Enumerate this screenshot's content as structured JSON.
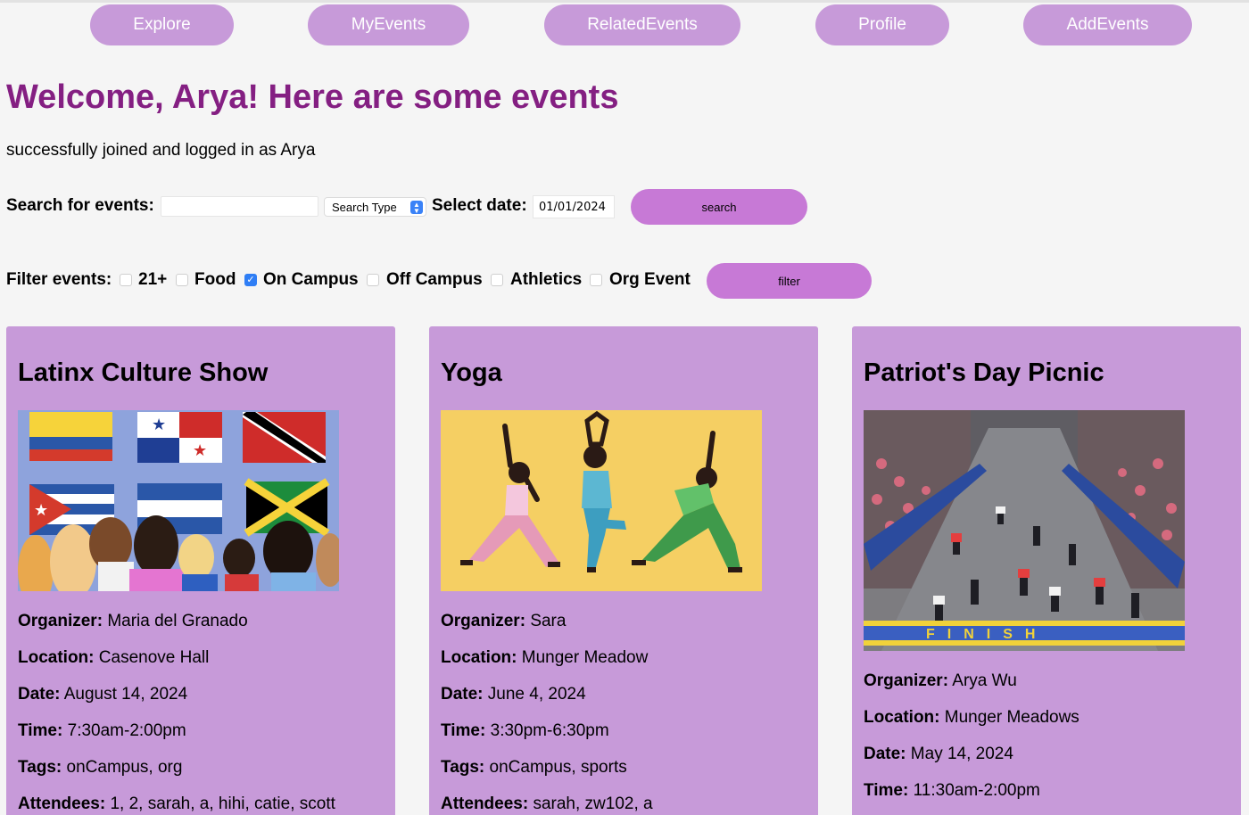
{
  "nav": {
    "items": [
      "Explore",
      "MyEvents",
      "RelatedEvents",
      "Profile",
      "AddEvents"
    ]
  },
  "page": {
    "title": "Welcome, Arya! Here are some events",
    "status": "successfully joined and logged in as Arya"
  },
  "search": {
    "label": "Search for events:",
    "value": "",
    "type_select": "Search Type",
    "date_label": "Select date:",
    "date_value": "01/01/2024",
    "button": "search"
  },
  "filter": {
    "label": "Filter events:",
    "options": [
      {
        "label": "21+",
        "checked": false
      },
      {
        "label": "Food",
        "checked": false
      },
      {
        "label": "On Campus",
        "checked": true
      },
      {
        "label": "Off Campus",
        "checked": false
      },
      {
        "label": "Athletics",
        "checked": false
      },
      {
        "label": "Org Event",
        "checked": false
      }
    ],
    "button": "filter"
  },
  "labels": {
    "organizer": "Organizer:",
    "location": "Location:",
    "date": "Date:",
    "time": "Time:",
    "tags": "Tags:",
    "attendees": "Attendees:"
  },
  "events": [
    {
      "title": "Latinx Culture Show",
      "organizer": "Maria del Granado",
      "location": "Casenove Hall",
      "date": "August 14, 2024",
      "time": "7:30am-2:00pm",
      "tags": "onCampus, org",
      "attendees": "1, 2, sarah, a, hihi, catie, scott"
    },
    {
      "title": "Yoga",
      "organizer": "Sara",
      "location": "Munger Meadow",
      "date": "June 4, 2024",
      "time": "3:30pm-6:30pm",
      "tags": "onCampus, sports",
      "attendees": "sarah, zw102, a"
    },
    {
      "title": "Patriot's Day Picnic",
      "organizer": "Arya Wu",
      "location": "Munger Meadows",
      "date": "May 14, 2024",
      "time": "11:30am-2:00pm"
    }
  ],
  "colors": {
    "accent": "#c79ad9",
    "title": "#841f82",
    "card": "#c79ad9",
    "button": "#c779d6"
  }
}
